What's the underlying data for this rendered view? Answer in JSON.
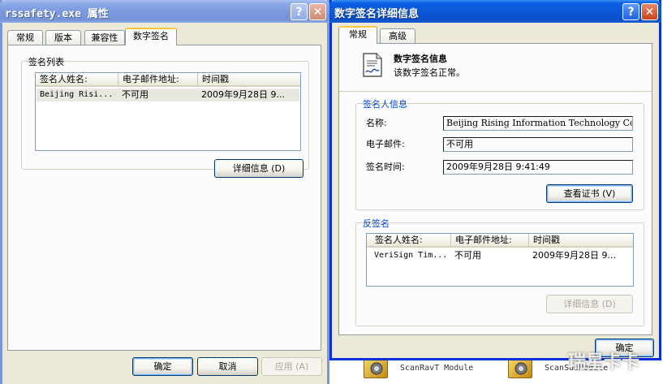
{
  "background_items": [
    {
      "label": "ScanRavT Module",
      "icon": "gear-app-icon"
    },
    {
      "label": "ScanSubModule",
      "icon": "gear-app-icon"
    }
  ],
  "left_window": {
    "title": "rssafety.exe 属性",
    "help_glyph": "?",
    "close_glyph": "✕",
    "tabs": [
      "常规",
      "版本",
      "兼容性",
      "数字签名"
    ],
    "active_tab": "数字签名",
    "group_label": "签名列表",
    "columns": [
      "签名人姓名:",
      "电子邮件地址:",
      "时间戳"
    ],
    "rows": [
      {
        "signer": "Beijing Risi...",
        "email": "不可用",
        "timestamp": "2009年9月28日 9..."
      }
    ],
    "details_button": "详细信息 (D)",
    "ok_button": "确定",
    "cancel_button": "取消",
    "apply_button": "应用 (A)"
  },
  "right_window": {
    "title": "数字签名详细信息",
    "help_glyph": "?",
    "close_glyph": "✕",
    "tabs": [
      "常规",
      "高级"
    ],
    "active_tab": "常规",
    "info_heading": "数字签名信息",
    "info_status": "该数字签名正常。",
    "signer_group_label": "签名人信息",
    "name_label": "名称:",
    "name_value": "Beijing Rising Information Technology Co",
    "email_label": "电子邮件:",
    "email_value": "不可用",
    "sign_time_label": "签名时间:",
    "sign_time_value": "2009年9月28日 9:41:49",
    "view_cert_button": "查看证书 (V)",
    "countersign_group_label": "反签名",
    "columns": [
      "签名人姓名:",
      "电子邮件地址:",
      "时间戳"
    ],
    "rows": [
      {
        "signer": "VeriSign Tim...",
        "email": "不可用",
        "timestamp": "2009年9月28日 9..."
      }
    ],
    "details_button": "详细信息 (D)",
    "ok_button": "确定"
  },
  "watermark": "瑞星卡卡"
}
